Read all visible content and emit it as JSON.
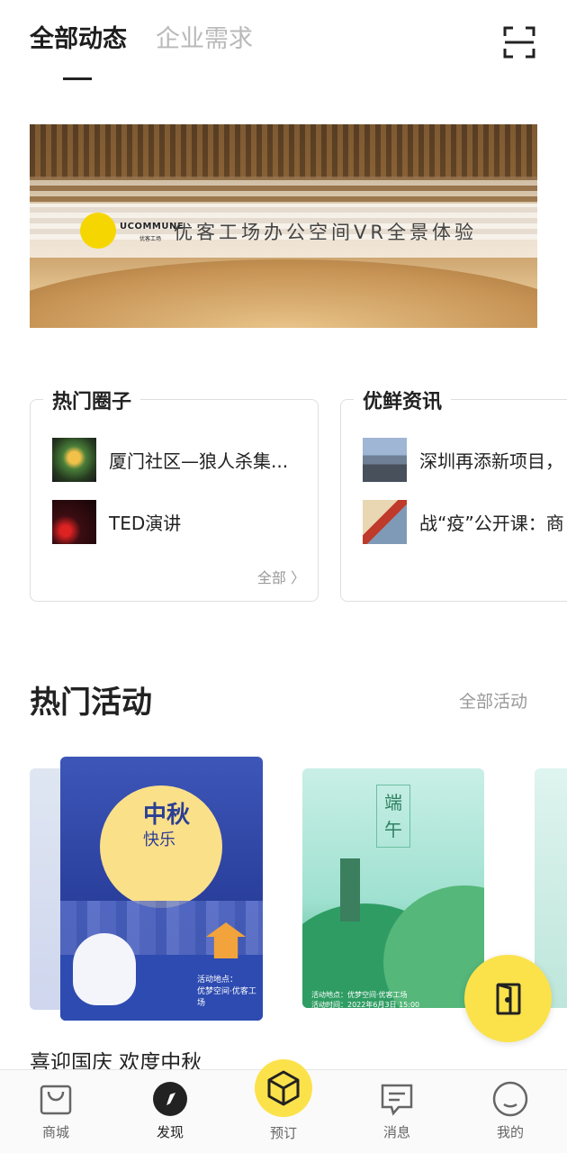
{
  "top_tabs": [
    "全部动态",
    "企业需求"
  ],
  "banner": {
    "logo_text": "UCOMMUNE",
    "logo_sub": "优客工场",
    "title": "优客工场办公空间VR全景体验"
  },
  "hot_circles": {
    "title": "热门圈子",
    "items": [
      "厦门社区—狼人杀集...",
      "TED演讲"
    ],
    "more": "全部 〉"
  },
  "news": {
    "title": "优鲜资讯",
    "items": [
      "深圳再添新项目，",
      "战“疫”公开课：商"
    ]
  },
  "hot_events": {
    "title": "热门活动",
    "more": "全部活动",
    "poster1": {
      "title": "中秋",
      "subtitle": "快乐",
      "info_line1": "活动地点：",
      "info_line2": "优梦空间·优客工场"
    },
    "poster2": {
      "title": "端午",
      "info_line1": "活动地点：优梦空间·优客工场",
      "info_line2": "活动时间：2022年6月3日 15:00"
    },
    "caption": "喜迎国庆 欢度中秋"
  },
  "bottom_nav": [
    "商城",
    "发现",
    "预订",
    "消息",
    "我的"
  ],
  "icons": {
    "scan": "scan-icon",
    "door": "door-icon",
    "bag": "shopping-bag-icon",
    "compass": "compass-icon",
    "box": "cube-icon",
    "message": "message-icon",
    "profile": "smile-profile-icon"
  },
  "colors": {
    "accent": "#fbe24b",
    "text": "#222222",
    "muted": "#999999"
  }
}
